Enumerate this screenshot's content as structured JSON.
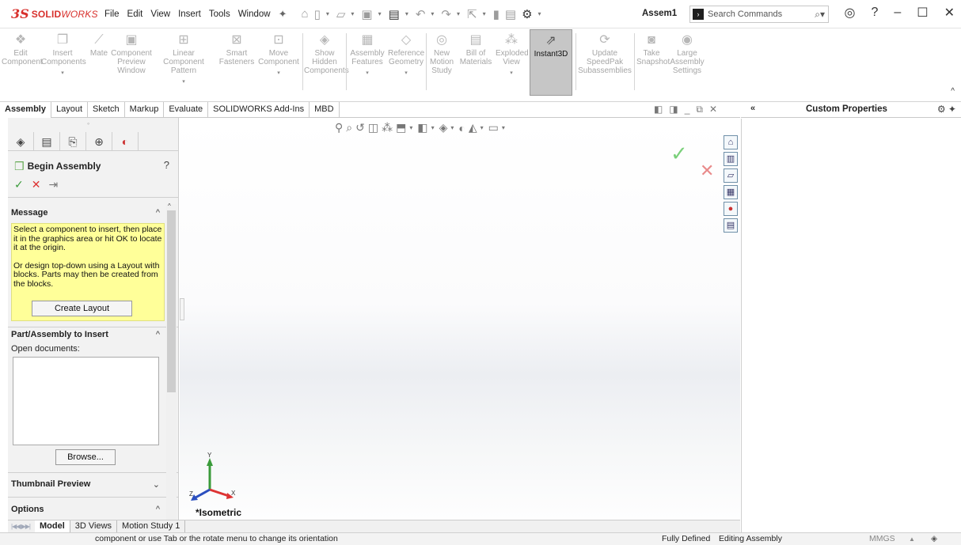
{
  "app": {
    "brand_ds": "3S",
    "brand_name_bold": "SOLID",
    "brand_name_italic": "WORKS",
    "doc_name": "Assem1"
  },
  "menu": [
    "File",
    "Edit",
    "View",
    "Insert",
    "Tools",
    "Window"
  ],
  "search": {
    "placeholder": "Search Commands"
  },
  "command_manager": {
    "buttons": [
      {
        "label": "Edit Component",
        "icon": "edit-component-icon"
      },
      {
        "label": "Insert Components",
        "icon": "insert-components-icon"
      },
      {
        "label": "Mate",
        "icon": "mate-icon"
      },
      {
        "label": "Component Preview Window",
        "icon": "component-preview-icon"
      },
      {
        "label": "Linear Component Pattern",
        "icon": "linear-pattern-icon"
      },
      {
        "label": "Smart Fasteners",
        "icon": "smart-fasteners-icon"
      },
      {
        "label": "Move Component",
        "icon": "move-component-icon"
      },
      {
        "label": "Show Hidden Components",
        "icon": "show-hidden-icon"
      },
      {
        "label": "Assembly Features",
        "icon": "assembly-features-icon"
      },
      {
        "label": "Reference Geometry",
        "icon": "reference-geometry-icon"
      },
      {
        "label": "New Motion Study",
        "icon": "motion-study-icon"
      },
      {
        "label": "Bill of Materials",
        "icon": "bom-icon"
      },
      {
        "label": "Exploded View",
        "icon": "exploded-view-icon"
      },
      {
        "label": "Instant3D",
        "icon": "instant3d-icon",
        "active": true
      },
      {
        "label": "Update SpeedPak Subassemblies",
        "icon": "speedpak-icon"
      },
      {
        "label": "Take Snapshot",
        "icon": "snapshot-icon"
      },
      {
        "label": "Large Assembly Settings",
        "icon": "large-assembly-icon"
      }
    ]
  },
  "tabs": [
    "Assembly",
    "Layout",
    "Sketch",
    "Markup",
    "Evaluate",
    "SOLIDWORKS Add-Ins",
    "MBD"
  ],
  "property_manager": {
    "title": "Begin Assembly",
    "message_header": "Message",
    "message_p1": "Select a component to insert, then place it in the graphics area or hit OK to locate it at the origin.",
    "message_p2": "Or design top-down using a Layout with blocks. Parts may then be created from the blocks.",
    "create_layout": "Create Layout",
    "part_header": "Part/Assembly to Insert",
    "open_docs_label": "Open documents:",
    "browse": "Browse...",
    "thumbnail_header": "Thumbnail Preview",
    "options_header": "Options"
  },
  "task_pane": {
    "title": "Custom Properties"
  },
  "graphics": {
    "view_name": "*Isometric"
  },
  "bottom_tabs": [
    "Model",
    "3D Views",
    "Motion Study 1"
  ],
  "status": {
    "message": "component or use Tab or the rotate menu to change its orientation",
    "state": "Fully Defined",
    "mode": "Editing Assembly",
    "units": "MMGS"
  },
  "colors": {
    "brand": "#d8312d",
    "message_bg": "#ffff99",
    "ok": "#3a9b3a",
    "cancel": "#d33333"
  }
}
